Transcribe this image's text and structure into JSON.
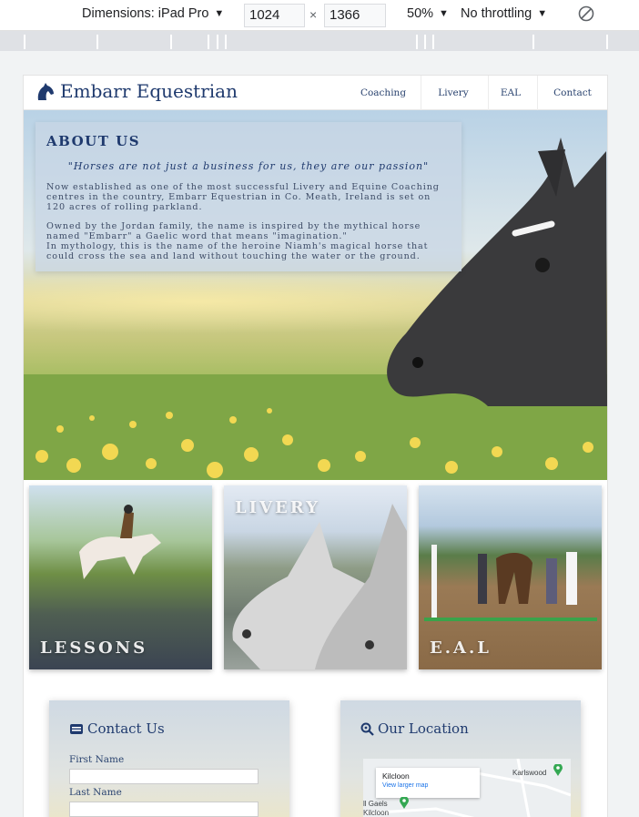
{
  "devtools": {
    "dimensions_label": "Dimensions: iPad Pro",
    "width_value": "1024",
    "times": "×",
    "height_value": "1366",
    "zoom": "50%",
    "throttling": "No throttling"
  },
  "site": {
    "brand": "Embarr Equestrian",
    "nav": [
      "Coaching",
      "Livery",
      "EAL",
      "Contact"
    ],
    "colors": {
      "primary": "#1f3a6e",
      "accent": "#2b4470"
    }
  },
  "about": {
    "title": "ABOUT US",
    "quote": "\"Horses are not just a business for us, they are our passion\"",
    "para1": "Now established as one of the most successful Livery and Equine Coaching centres in the country, Embarr Equestrian in Co. Meath, Ireland is set on 120 acres of rolling parkland.",
    "para2_line1": "Owned by the Jordan family, the name is inspired by the mythical horse named \"Embarr\" a Gaelic word that means \"imagination.\"",
    "para2_line2": "In mythology, this is the name of the heroine Niamh's magical horse that could cross the sea and land without touching the water or the ground."
  },
  "cards": {
    "lessons": "LESSONS",
    "livery": "LIVERY",
    "eal": "E.A.L"
  },
  "contact": {
    "title": "Contact Us",
    "first_name": "First Name",
    "last_name": "Last Name"
  },
  "location": {
    "title": "Our Location",
    "place": "Kilcloon",
    "map_link": "View larger map",
    "label_karlswood": "Karlswood",
    "label_gaels": "ll Gaels",
    "label_kilcloon2": "Kilcloon"
  }
}
